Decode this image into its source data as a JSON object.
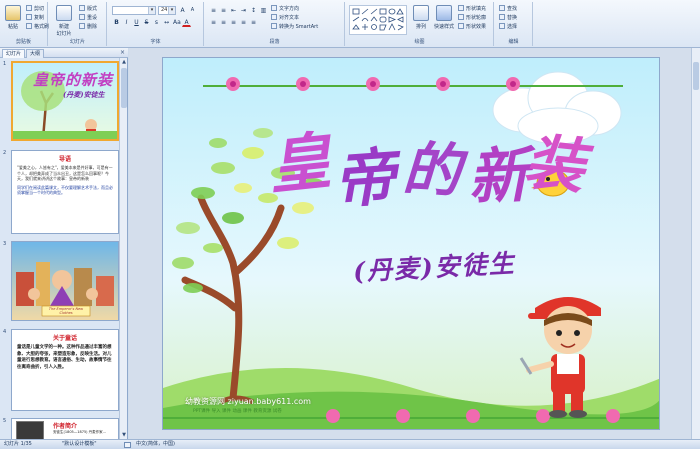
{
  "ribbon": {
    "clipboard": {
      "label": "剪贴板",
      "paste": "粘贴",
      "cut": "剪切",
      "copy": "复制",
      "format_painter": "格式刷"
    },
    "slides": {
      "label": "幻灯片",
      "new_slide": "新建\n幻灯片",
      "layout": "版式",
      "reset": "重设",
      "delete": "删除"
    },
    "font": {
      "label": "字体",
      "font_name": "",
      "font_size": "24"
    },
    "paragraph": {
      "label": "段落",
      "text_direction": "文字方向",
      "align_text": "对齐文本",
      "smartart": "转换为 SmartArt"
    },
    "drawing": {
      "label": "绘图",
      "arrange": "排列",
      "quick_styles": "快速样式",
      "shape_fill": "形状填充",
      "shape_outline": "形状轮廓",
      "shape_effects": "形状效果"
    },
    "editing": {
      "label": "编辑",
      "find": "查找",
      "replace": "替换",
      "select": "选择"
    }
  },
  "left_pane": {
    "tab_slides": "幻灯片",
    "tab_outline": "大纲",
    "close": "×",
    "thumbnails": [
      {
        "num": "1",
        "title": "皇帝的新装",
        "subtitle": "(丹麦)安徒生"
      },
      {
        "num": "2",
        "heading": "导语",
        "body": "\"爱美之心，人皆有之\"，爱美本来是件好事，可是有一个人，却把美弄成了当众出丑，这是怎么回事呢？今天，我们就来讲讲这个故事：皇帝的新装",
        "note": "同学们在阅读此篇课文，不仅要理解艺术手法，而且必须掌握当一个时代的典型。"
      },
      {
        "num": "3",
        "banner": "The Emperor's New Clothes"
      },
      {
        "num": "4",
        "heading": "关于童话",
        "body": "童话是儿童文学的一种。这种作品通过丰富的想象、大胆的夸张，来塑造形象，反映生活。对儿童进行思想教育。语言通俗、生动，故事情节往往离奇曲折，引人入胜。"
      },
      {
        "num": "5",
        "heading": "作者简介",
        "body": "安徒生(1805—1875) 丹麦作家..."
      }
    ]
  },
  "slide": {
    "title_chars": [
      "皇",
      "帝",
      "的",
      "新",
      "装"
    ],
    "subtitle": "(丹麦)安徒生",
    "watermark_1": "幼教资源网 ziyuan.baby611.com",
    "watermark_2": "PPT课件  导入 课件  动画 课件  教育资源  试卷"
  },
  "status_bar": {
    "slide_pos": "幻灯片 1/35",
    "theme": "\"默认设计模板\"",
    "language": "中文(简体，中国)"
  },
  "colors": {
    "ribbon_bg": "#dbe6f4",
    "title_purple": "#b03ec8",
    "title_magenta": "#e050c8",
    "subtitle": "#7a2aa8",
    "selection": "#f0a830",
    "slide_sky": "#bfeefc"
  }
}
